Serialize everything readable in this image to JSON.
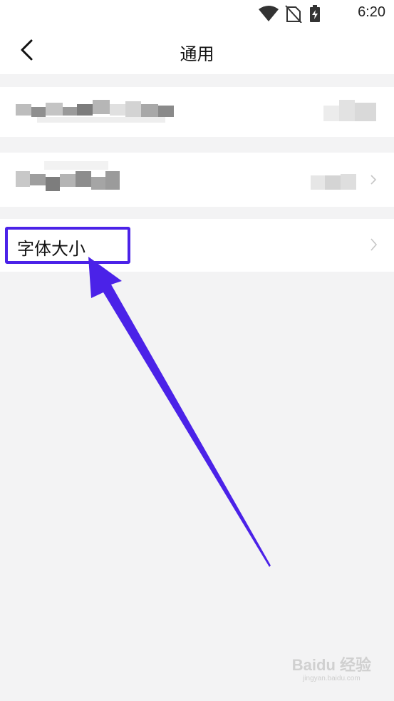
{
  "status_bar": {
    "time": "6:20",
    "icons": [
      "wifi-icon",
      "no-sim-icon",
      "battery-charging-icon"
    ]
  },
  "header": {
    "title": "通用"
  },
  "settings": {
    "font_size_label": "字体大小"
  },
  "annotation": {
    "highlight_color": "#4b22e8",
    "arrow_color": "#4b22e8"
  },
  "watermark": {
    "brand": "Baidu 经验",
    "url": "jingyan.baidu.com"
  }
}
